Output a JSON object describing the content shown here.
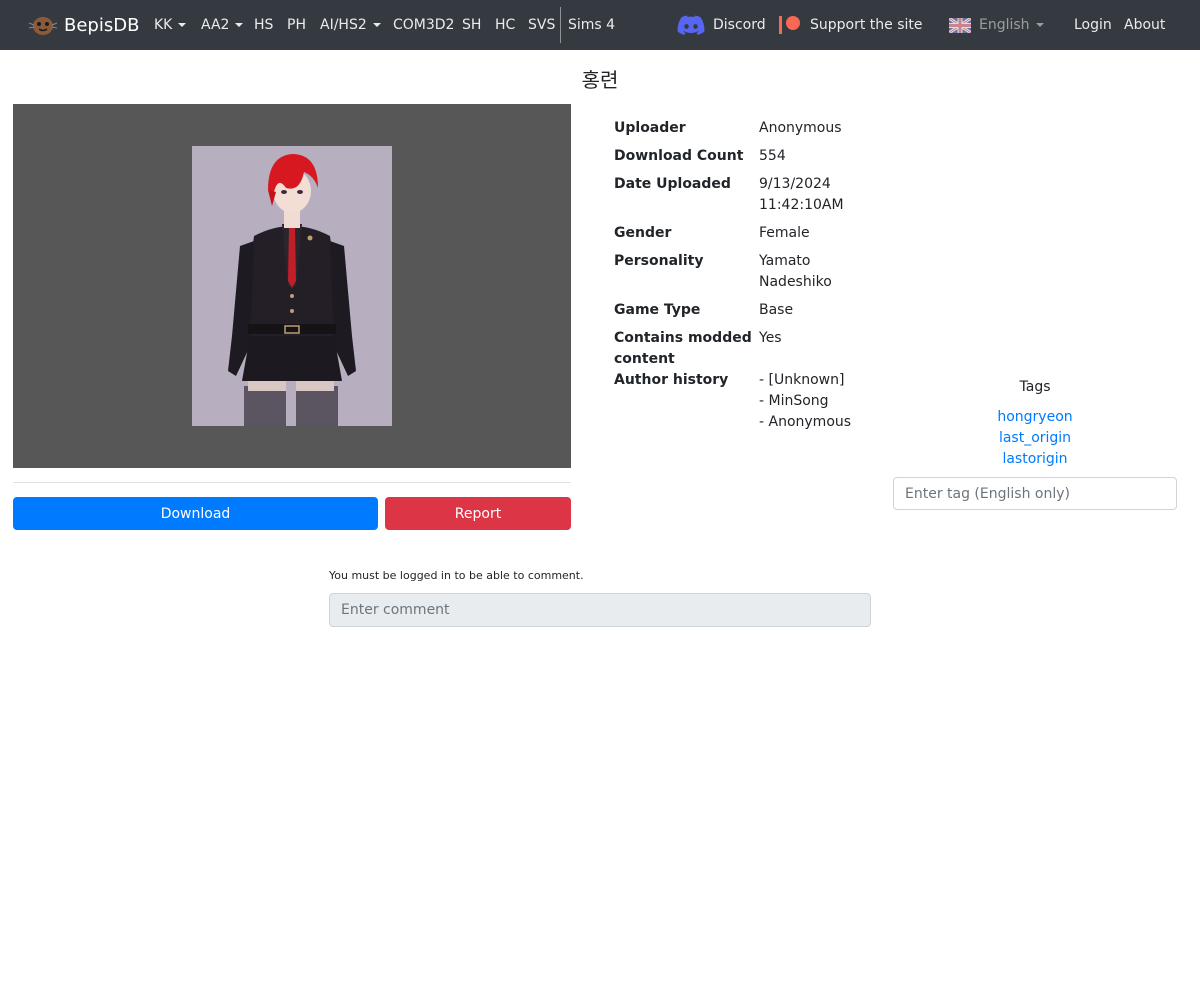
{
  "nav": {
    "brand": "BepisDB",
    "items": [
      {
        "label": "KK",
        "dropdown": true
      },
      {
        "label": "AA2",
        "dropdown": true
      },
      {
        "label": "HS",
        "dropdown": false
      },
      {
        "label": "PH",
        "dropdown": false
      },
      {
        "label": "AI/HS2",
        "dropdown": true
      },
      {
        "label": "COM3D2",
        "dropdown": false
      },
      {
        "label": "SH",
        "dropdown": false
      },
      {
        "label": "HC",
        "dropdown": false
      },
      {
        "label": "SVS",
        "dropdown": false
      },
      {
        "label": "Sims 4",
        "dropdown": false
      }
    ],
    "discord": "Discord",
    "support": "Support the site",
    "language": "English",
    "login": "Login",
    "about": "About"
  },
  "card": {
    "title": "홍련",
    "info": [
      {
        "key": "Uploader",
        "value": "Anonymous"
      },
      {
        "key": "Download Count",
        "value": "554"
      },
      {
        "key": "Date Uploaded",
        "value": "9/13/2024 11:42:10AM"
      },
      {
        "key": "Gender",
        "value": "Female"
      },
      {
        "key": "Personality",
        "value": "Yamato Nadeshiko"
      },
      {
        "key": "Game Type",
        "value": "Base"
      },
      {
        "key": "Contains modded content",
        "value": "Yes"
      },
      {
        "key": "Author history",
        "value": "- [Unknown]\n- MinSong\n- Anonymous"
      }
    ],
    "download_label": "Download",
    "report_label": "Report"
  },
  "tags": {
    "title": "Tags",
    "items": [
      "hongryeon",
      "last_origin",
      "lastorigin"
    ],
    "input_placeholder": "Enter tag (English only)"
  },
  "comments": {
    "note": "You must be logged in to be able to comment.",
    "input_placeholder": "Enter comment"
  },
  "colors": {
    "navbar": "#343a40",
    "primary": "#007bff",
    "danger": "#dc3545",
    "discord": "#5865f2",
    "patreon": "#f96854"
  }
}
